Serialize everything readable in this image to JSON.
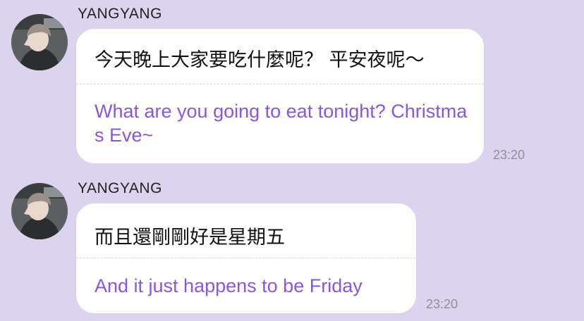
{
  "chat": {
    "messages": [
      {
        "sender": "YANGYANG",
        "original": "今天晚上大家要吃什麼呢？ 平安夜呢～",
        "translation": "What are you going to eat tonight? Christmas Eve~",
        "time": "23:20"
      },
      {
        "sender": "YANGYANG",
        "original": "而且還剛剛好是星期五",
        "translation": "And it just happens to be Friday",
        "time": "23:20"
      }
    ]
  },
  "colors": {
    "background": "#dcd3ee",
    "bubble": "#ffffff",
    "translation_text": "#8a56e0",
    "timestamp": "#8f8f93"
  },
  "icons": {
    "avatar": "profile-photo"
  }
}
